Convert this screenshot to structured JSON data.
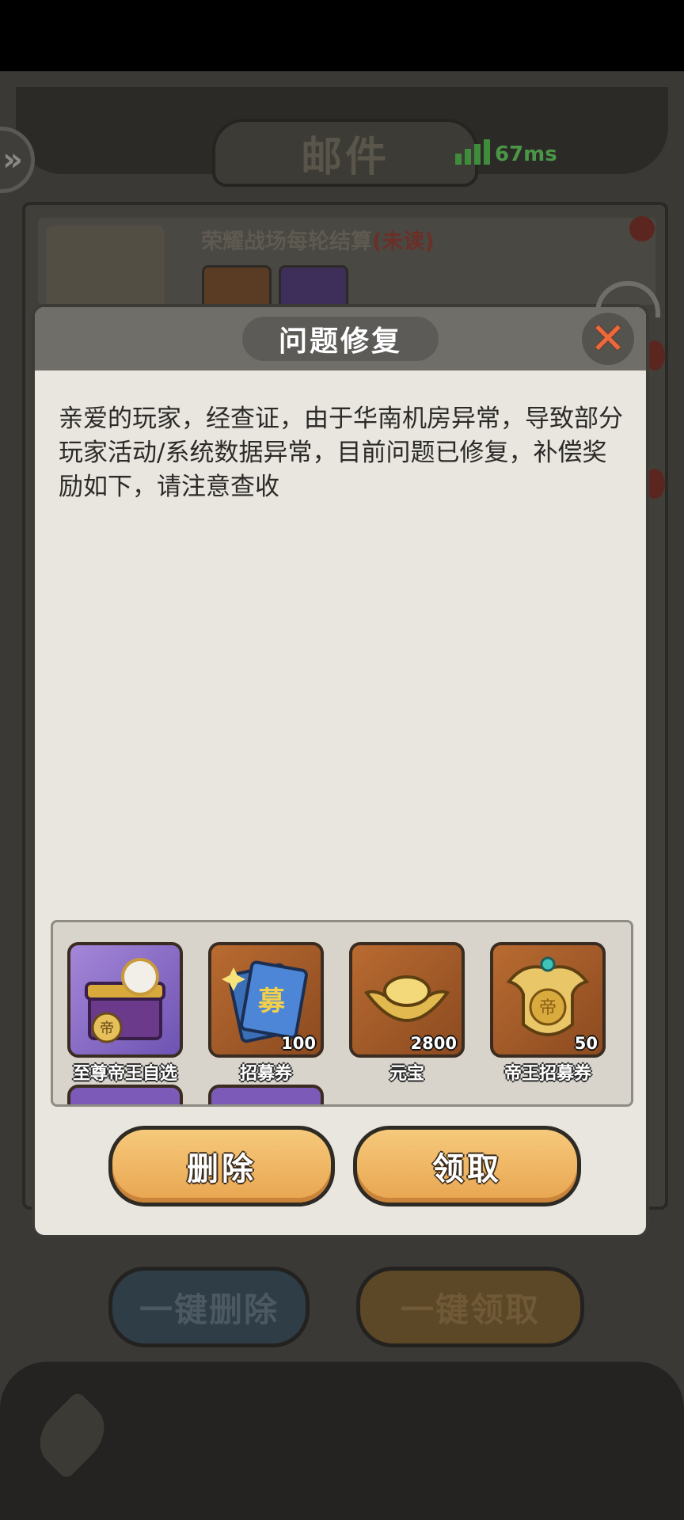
{
  "background": {
    "screen_title": "邮件",
    "ping": "67ms",
    "mail_item": {
      "title": "荣耀战场每轮结算",
      "status": "(未读)"
    },
    "bottom_buttons": {
      "delete_all": "一键删除",
      "claim_all": "一键领取"
    }
  },
  "dialog": {
    "title": "问题修复",
    "message": "亲爱的玩家，经查证，由于华南机房异常，导致部分玩家活动/系统数据异常，目前问题已修复，补偿奖励如下，请注意查收",
    "rewards": [
      {
        "name": "至尊帝王自选",
        "quantity": "",
        "icon": "treasure-chest-icon"
      },
      {
        "name": "招募券",
        "quantity": "100",
        "icon": "recruit-ticket-icon"
      },
      {
        "name": "元宝",
        "quantity": "2800",
        "icon": "gold-ingot-icon"
      },
      {
        "name": "帝王招募券",
        "quantity": "50",
        "icon": "emperor-token-icon"
      }
    ],
    "delete_button": "删除",
    "claim_button": "领取"
  },
  "colors": {
    "button_gold": "#e8a550",
    "close_x": "#f0673a",
    "ping_green": "#4a9646",
    "unread_red": "#6a3028"
  }
}
